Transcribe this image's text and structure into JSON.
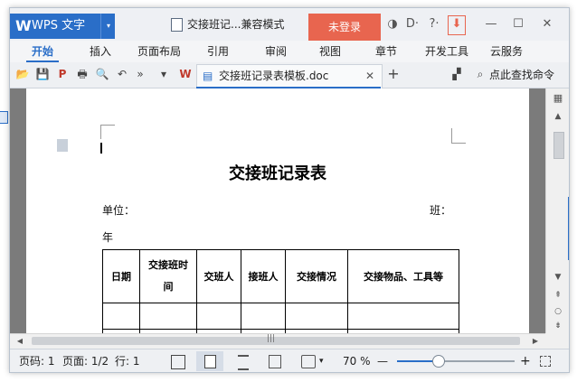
{
  "app": {
    "logo": "W",
    "name": "WPS 文字",
    "dropdown": "▾"
  },
  "title": {
    "document": "交接班记...兼容模式",
    "login": "未登录",
    "icons": [
      "shield-icon",
      "skin-icon",
      "help-icon",
      "minimize-to-tray-icon",
      "minimize-icon",
      "maximize-icon",
      "close-icon"
    ],
    "glyphs": {
      "shield": "◑",
      "skin": "D·",
      "help": "?·",
      "more": "·",
      "tray": "⬇",
      "min": "—",
      "max": "☐",
      "close": "✕"
    }
  },
  "menu": {
    "items": [
      "开始",
      "插入",
      "页面布局",
      "引用",
      "审阅",
      "视图",
      "章节",
      "开发工具",
      "云服务"
    ],
    "active": "开始"
  },
  "toolbar": {
    "doc_tab": "交接班记录表模板.doc",
    "doc_close": "✕",
    "new_tab": "+",
    "search": "点此查找命令",
    "icons": {
      "open": "📂",
      "save": "💾",
      "pdf": "P",
      "print": "🖶",
      "preview": "🔍",
      "undo": "↶",
      "redo": "»",
      "more": "▾",
      "wps": "W",
      "doc": "▤",
      "plus": "+",
      "pin": "▞",
      "search": "⌕"
    }
  },
  "document": {
    "title": "交接班记录表",
    "unit_label": "单位：",
    "shift_label": "班：",
    "year_label": "年",
    "table_headers": [
      "日期",
      "交接班时间",
      "交班人",
      "接班人",
      "交接情况",
      "交接物品、工具等"
    ],
    "header_line2": "间",
    "header_line1_time": "交接班时"
  },
  "scrollbar": {
    "up": "▲",
    "down": "▼",
    "prev": "⇞",
    "select": "○",
    "next": "⇟",
    "hmid": "|||",
    "left": "◀",
    "right": "▶"
  },
  "status": {
    "page_num": "页码: 1",
    "pages": "页面: 1/2",
    "line": "行: 1",
    "zoom": "70 %",
    "zoom_minus": "—",
    "zoom_plus": "+",
    "zoom_fraction": 0.35
  },
  "colors": {
    "accent": "#2a6ec8",
    "login_bg": "#e8654f",
    "page_bg": "#7b7b7b"
  }
}
